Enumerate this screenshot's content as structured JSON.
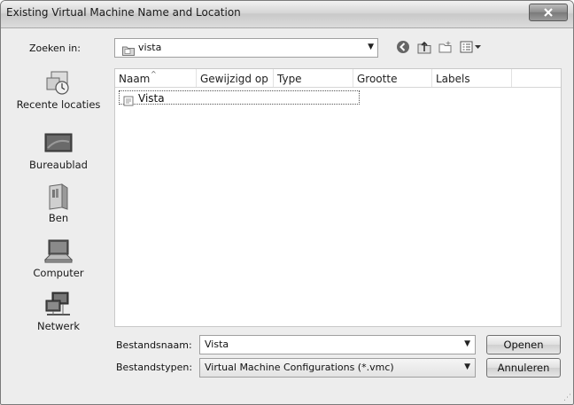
{
  "window": {
    "title": "Existing Virtual Machine Name and Location",
    "close_icon": "close-icon"
  },
  "lookin": {
    "label": "Zoeken in:",
    "value": "vista"
  },
  "toolbar": {
    "icons": [
      "back-icon",
      "up-folder-icon",
      "new-folder-icon",
      "view-menu-icon"
    ]
  },
  "places": [
    {
      "label": "Recente locaties",
      "icon": "recent-places-icon"
    },
    {
      "label": "Bureaublad",
      "icon": "desktop-icon"
    },
    {
      "label": "Ben",
      "icon": "user-folder-icon"
    },
    {
      "label": "Computer",
      "icon": "computer-icon"
    },
    {
      "label": "Netwerk",
      "icon": "network-icon"
    }
  ],
  "list": {
    "columns": [
      "Naam",
      "Gewijzigd op",
      "Type",
      "Grootte",
      "Labels"
    ],
    "items": [
      {
        "name": "Vista",
        "icon": "file-icon"
      }
    ]
  },
  "filename": {
    "label": "Bestandsnaam:",
    "value": "Vista"
  },
  "filetype": {
    "label": "Bestandstypen:",
    "value": "Virtual Machine Configurations (*.vmc)"
  },
  "buttons": {
    "open": "Openen",
    "cancel": "Annuleren"
  },
  "colors": {
    "dialog_bg": "#ededed",
    "list_bg": "#ffffff",
    "border": "#a0a0a0"
  }
}
